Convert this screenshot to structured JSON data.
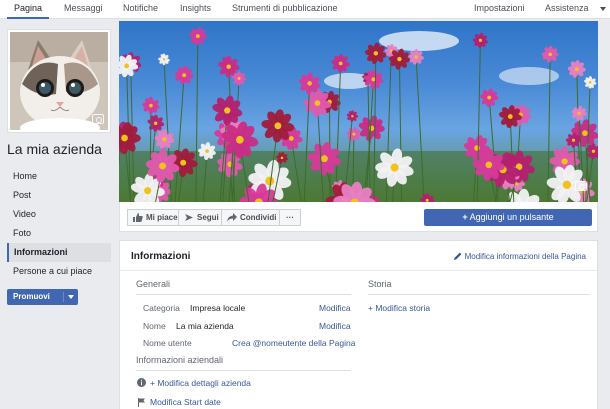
{
  "topnav": {
    "tabs": [
      "Pagina",
      "Messaggi",
      "Notifiche",
      "Insights",
      "Strumenti di pubblicazione"
    ],
    "right": [
      "Impostazioni",
      "Assistenza"
    ]
  },
  "page": {
    "name": "La mia azienda"
  },
  "sidebar": {
    "items": [
      "Home",
      "Post",
      "Video",
      "Foto",
      "Informazioni",
      "Persone a cui piace"
    ],
    "active": "Informazioni",
    "promote_label": "Promuovi"
  },
  "actions": {
    "like": "Mi piace",
    "follow": "Segui",
    "share": "Condividi",
    "more": "···",
    "add_button": "Aggiungi un pulsante"
  },
  "info": {
    "title": "Informazioni",
    "edit_link": "Modifica informazioni della Pagina",
    "general": {
      "title": "Generali",
      "rows": [
        {
          "label": "Categoria",
          "value": "Impresa locale",
          "action": "Modifica"
        },
        {
          "label": "Nome",
          "value": "La mia azienda",
          "action": "Modifica"
        },
        {
          "label": "Nome utente",
          "value": "",
          "action": "Crea @nomeutente della Pagina"
        }
      ]
    },
    "business": {
      "title": "Informazioni aziendali",
      "items": [
        "+ Modifica dettagli azienda",
        "Modifica Start date"
      ]
    },
    "story": {
      "title": "Storia",
      "action": "+ Modifica storia"
    }
  },
  "colors": {
    "brand": "#4267b2",
    "link": "#365899",
    "background": "#e9ebee"
  },
  "icons": [
    "camera-icon",
    "like-icon",
    "follow-icon",
    "share-icon",
    "plus-icon",
    "pencil-icon",
    "info-icon",
    "flag-icon"
  ]
}
